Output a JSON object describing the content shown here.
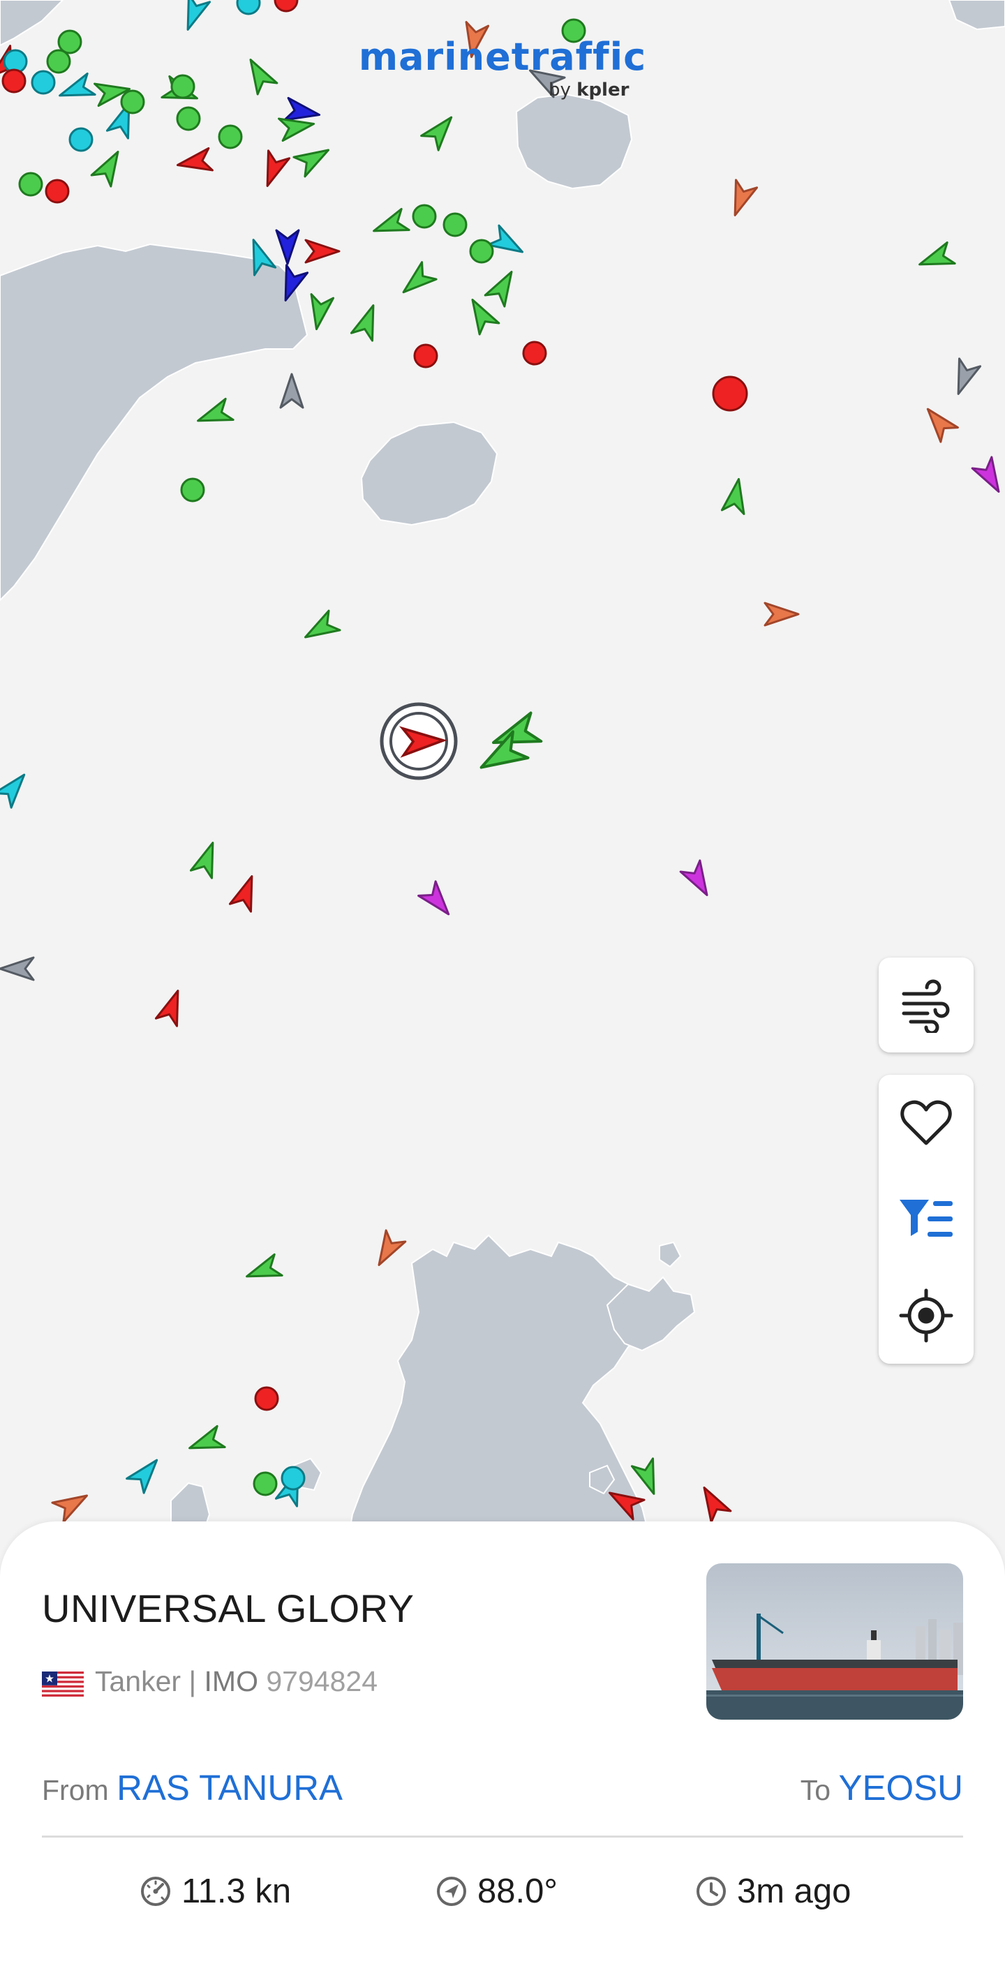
{
  "brand": {
    "name": "marinetraffic",
    "by": "by",
    "company": "kpler"
  },
  "map_controls": {
    "weather_icon": "wind-icon",
    "favorite_icon": "heart-icon",
    "filter_icon": "filter-list-icon",
    "locate_icon": "crosshair-icon"
  },
  "vessel": {
    "name": "UNIVERSAL GLORY",
    "flag": "Liberia",
    "type": "Tanker",
    "separator": "|",
    "imo_label": "IMO",
    "imo": "9794824",
    "from_label": "From",
    "from": "RAS TANURA",
    "to_label": "To",
    "to": "YEOSU"
  },
  "stats": {
    "speed": "11.3 kn",
    "course": "88.0°",
    "last_update": "3m ago"
  },
  "colors": {
    "accent": "#1f6fd6",
    "land": "#c3c9d1",
    "sea": "#f3f3f3",
    "cargo_green": "#4ccc4c",
    "tanker_red": "#ee2222",
    "passenger_blue": "#2222dd",
    "tug_cyan": "#22ccdd",
    "fishing_orange": "#e8774a",
    "pleasure_magenta": "#cc33dd",
    "unknown_gray": "#9aa0aa"
  }
}
